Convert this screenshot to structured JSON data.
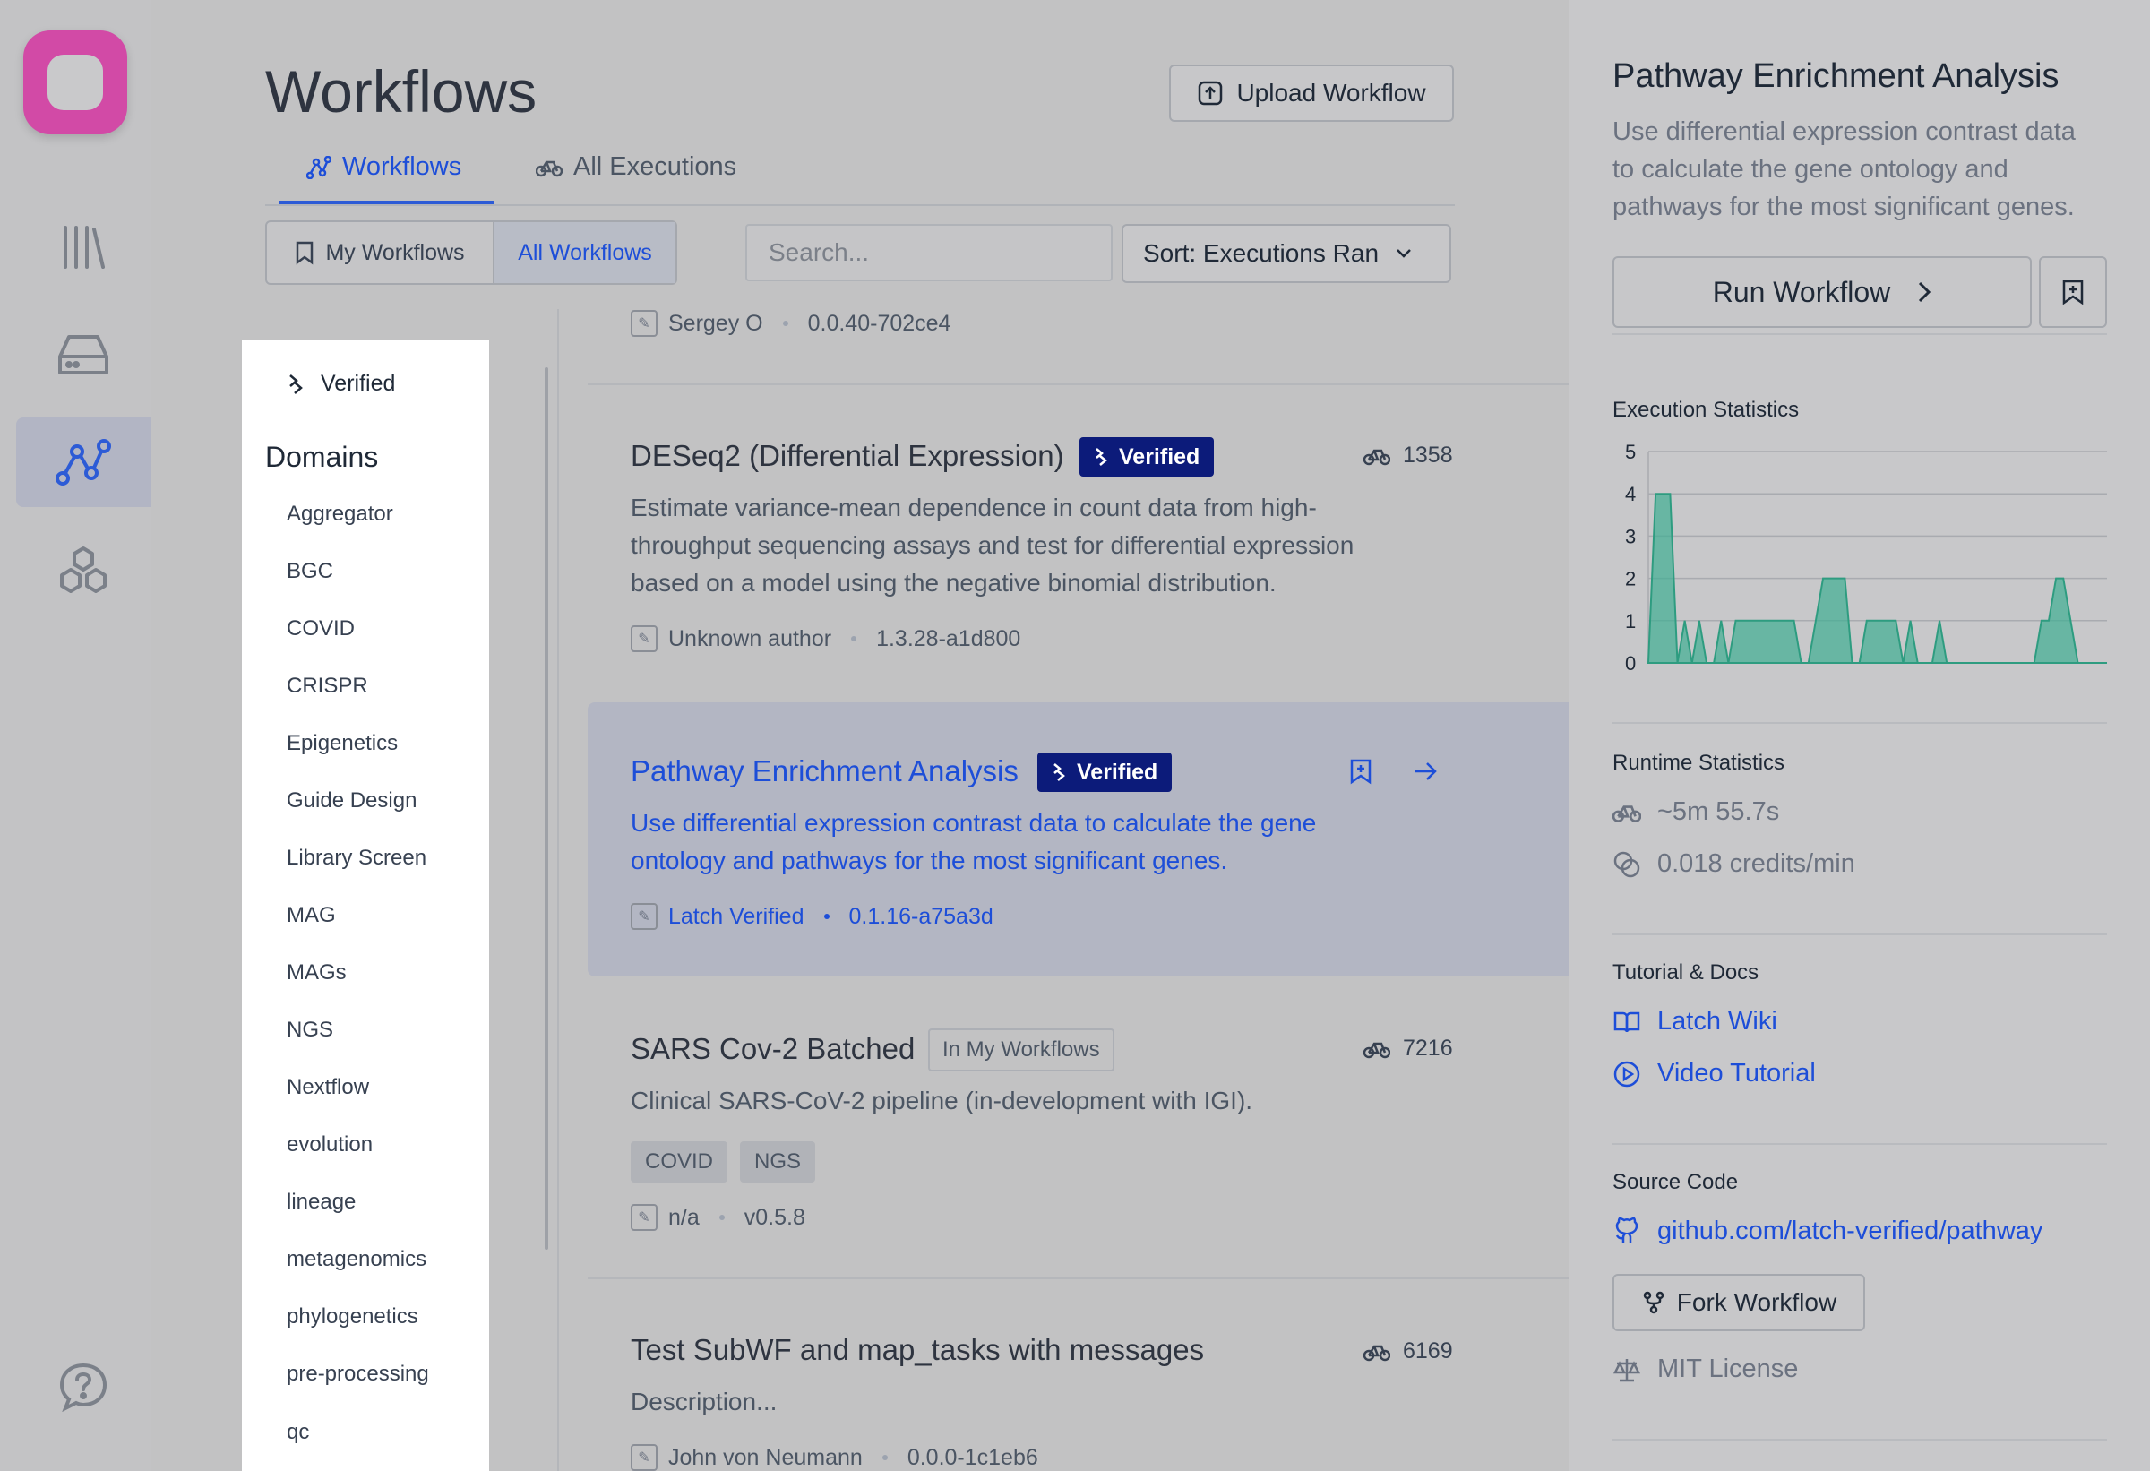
{
  "header": {
    "title": "Workflows",
    "upload_label": "Upload Workflow"
  },
  "tabs": [
    {
      "label": "Workflows"
    },
    {
      "label": "All Executions"
    }
  ],
  "filters": {
    "my_workflows": "My Workflows",
    "all_workflows": "All Workflows"
  },
  "search": {
    "placeholder": "Search..."
  },
  "sort": {
    "label": "Sort: Executions Ran"
  },
  "sidebar_filter": {
    "verified": "Verified",
    "domains_heading": "Domains",
    "domains": [
      "Aggregator",
      "BGC",
      "COVID",
      "CRISPR",
      "Epigenetics",
      "Guide Design",
      "Library Screen",
      "MAG",
      "MAGs",
      "NGS",
      "Nextflow",
      "evolution",
      "lineage",
      "metagenomics",
      "phylogenetics",
      "pre-processing",
      "qc"
    ]
  },
  "workflows": [
    {
      "author": "Sergey O",
      "version": "0.0.40-702ce4"
    },
    {
      "title": "DESeq2 (Differential Expression)",
      "badge": "Verified",
      "count": "1358",
      "desc": [
        "Estimate variance-mean dependence in count data from high-",
        "throughput sequencing assays and test for differential expression",
        "based on a model using the negative binomial distribution."
      ],
      "author": "Unknown author",
      "version": "1.3.28-a1d800"
    },
    {
      "title": "Pathway Enrichment Analysis",
      "badge": "Verified",
      "desc": [
        "Use differential expression contrast data to calculate the gene",
        "ontology and pathways for the most significant genes."
      ],
      "author": "Latch Verified",
      "version": "0.1.16-a75a3d"
    },
    {
      "title": "SARS Cov-2 Batched",
      "pill": "In My Workflows",
      "count": "7216",
      "desc": [
        "Clinical SARS-CoV-2 pipeline (in-development with IGI)."
      ],
      "tags": [
        "COVID",
        "NGS"
      ],
      "author": "n/a",
      "version": "v0.5.8"
    },
    {
      "title": "Test SubWF and map_tasks with messages",
      "count": "6169",
      "desc": [
        "Description..."
      ],
      "author": "John von Neumann",
      "version": "0.0.0-1c1eb6"
    }
  ],
  "detail": {
    "title": "Pathway Enrichment Analysis",
    "desc": [
      "Use differential expression contrast data",
      "to calculate the gene ontology and",
      "pathways for the most significant genes."
    ],
    "run_label": "Run Workflow",
    "exec_stats_heading": "Execution Statistics",
    "runtime_heading": "Runtime Statistics",
    "runtime": "~5m 55.7s",
    "credits": "0.018 credits/min",
    "tutorial_heading": "Tutorial & Docs",
    "wiki": "Latch Wiki",
    "video": "Video Tutorial",
    "source_heading": "Source Code",
    "repo": "github.com/latch-verified/pathway",
    "fork_label": "Fork Workflow",
    "license": "MIT License"
  },
  "chart_data": {
    "type": "area",
    "title": "Execution Statistics",
    "ylim": [
      0,
      5
    ],
    "yticks": [
      0,
      1,
      2,
      3,
      4,
      5
    ],
    "values": [
      0,
      4,
      4,
      4,
      0,
      1,
      0,
      1,
      0,
      0,
      1,
      0,
      1,
      1,
      1,
      1,
      1,
      1,
      1,
      1,
      1,
      0,
      0,
      1,
      2,
      2,
      2,
      2,
      0,
      0,
      1,
      1,
      1,
      1,
      1,
      0,
      1,
      0,
      0,
      0,
      1,
      0,
      0,
      0,
      0,
      0,
      0,
      0,
      0,
      0,
      0,
      0,
      0,
      0,
      1,
      1,
      2,
      2,
      1,
      0,
      0,
      0,
      0,
      0
    ],
    "color": "#3fae93",
    "grid": true
  },
  "colors": {
    "accent": "#1d4ed8",
    "badge": "#0c1b7a",
    "logo": "#d24aa6"
  }
}
